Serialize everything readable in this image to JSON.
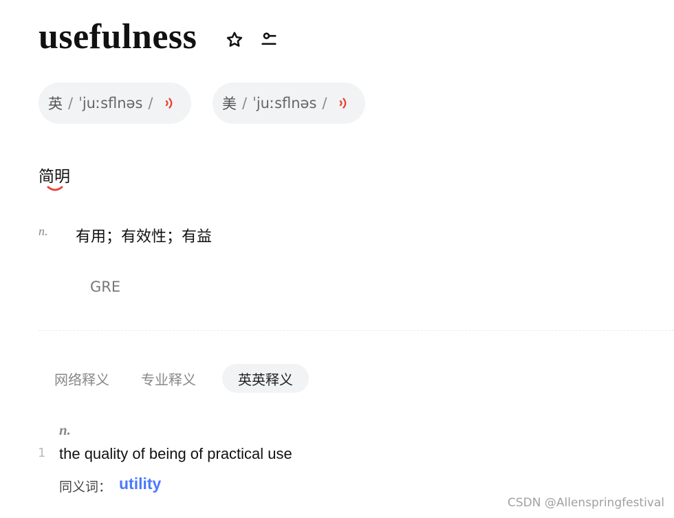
{
  "word": {
    "headword": "usefulness",
    "icons": [
      "star-outline-icon",
      "wordbook-icon"
    ]
  },
  "pronunciations": [
    {
      "region": "英",
      "open_slash": "/",
      "ipa": "ˈjuːsflnəs",
      "close_slash": "/",
      "icon": "speaker-icon"
    },
    {
      "region": "美",
      "open_slash": "/",
      "ipa": "ˈjuːsflnəs",
      "close_slash": "/",
      "icon": "speaker-icon"
    }
  ],
  "brief": {
    "title": "简明",
    "definitions": [
      {
        "pos": "n.",
        "meaning": "有用；有效性；有益"
      }
    ],
    "exam_tag": "GRE"
  },
  "tabs": [
    {
      "label": "网络释义",
      "active": false
    },
    {
      "label": "专业释义",
      "active": false
    },
    {
      "label": "英英释义",
      "active": true
    }
  ],
  "english": {
    "pos": "n.",
    "entries": [
      {
        "index": "1",
        "definition": "the quality of being of practical use",
        "synonym_label": "同义词：",
        "synonym": "utility"
      }
    ]
  },
  "watermark": "CSDN @Allenspringfestival",
  "colors": {
    "accent_red": "#e8463a",
    "link_blue": "#4a78ff",
    "pill_bg": "#f2f3f5"
  }
}
